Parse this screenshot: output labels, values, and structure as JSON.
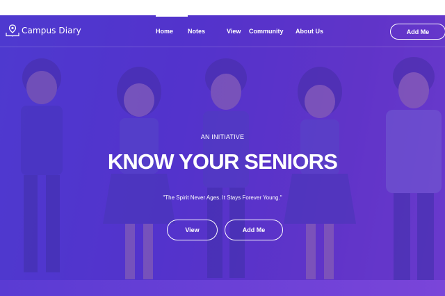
{
  "brand": {
    "name": "Campus Diary",
    "icon": "map-pin-book-icon"
  },
  "nav": {
    "items": [
      {
        "label": "Home",
        "active": true
      },
      {
        "label": "Notes",
        "active": false
      },
      {
        "label": "View",
        "active": false
      },
      {
        "label": "Community",
        "active": false
      },
      {
        "label": "About Us",
        "active": false
      }
    ],
    "cta_label": "Add Me"
  },
  "hero": {
    "eyebrow": "AN INITIATIVE",
    "headline": "KNOW YOUR SENIORS",
    "tagline": "\"The Spirit Never Ages. It Stays Forever Young.\"",
    "primary_button": "View",
    "secondary_button": "Add Me",
    "illustration": "students-group-illustration"
  },
  "colors": {
    "hero_gradient_start": "#4a3fd6",
    "hero_gradient_end": "#7a3fd0",
    "text": "#ffffff"
  }
}
